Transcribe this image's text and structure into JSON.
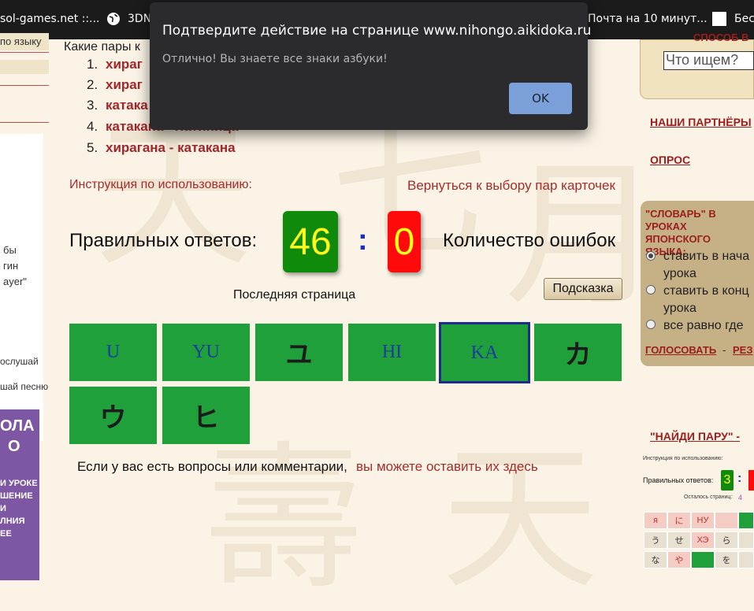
{
  "bookmarks": [
    {
      "label": "sol-games.net ::..."
    },
    {
      "label": "3DN"
    },
    {
      "label": "Почта на 10 минут..."
    },
    {
      "label": "Бес"
    }
  ],
  "dialog": {
    "title": "Подтвердите действие на странице www.nihongo.aikidoka.ru",
    "message": "Отлично! Вы знаете все знаки азбуки!",
    "ok_label": "OK"
  },
  "left": {
    "top_link": "по языку",
    "fragments": [
      "бы",
      "гин",
      "ayer\"",
      "ослушай",
      "шай песню"
    ],
    "promo_lines": [
      "ОЛА",
      "О",
      "И УРОКЕ",
      "ШЕНИЕ",
      "И",
      "ЛНИЯ",
      "ЕЕ"
    ]
  },
  "main": {
    "question": "Какие пары к",
    "pairs": [
      {
        "num": "1.",
        "label": "хираг"
      },
      {
        "num": "2.",
        "label": "хираг"
      },
      {
        "num": "3.",
        "label": "катака"
      },
      {
        "num": "4.",
        "label": "катакана - латиница"
      },
      {
        "num": "5.",
        "label": "хирагана - катакана"
      }
    ],
    "instructions_link": "Инструкция по использованию:",
    "back_link": "Вернуться к выбору пар карточек",
    "correct_label": "Правильных ответов:",
    "correct_count": "46",
    "separator": ":",
    "errors_count": "0",
    "errors_label": "Количество ошибок",
    "hint_label": "Подсказка",
    "last_page": "Последняя страница",
    "cards_row1": [
      {
        "text": "U",
        "type": "romaji"
      },
      {
        "text": "YU",
        "type": "romaji"
      },
      {
        "text": "ユ",
        "type": "kana"
      },
      {
        "text": "HI",
        "type": "romaji"
      },
      {
        "text": "KA",
        "type": "romaji",
        "selected": true
      },
      {
        "text": "カ",
        "type": "kana"
      }
    ],
    "cards_row2": [
      {
        "text": "ウ",
        "type": "kana"
      },
      {
        "text": "ヒ",
        "type": "kana"
      }
    ],
    "comments_text": "Если у вас есть вопросы или комментарии,",
    "comments_link": "вы можете оставить их здесь"
  },
  "right": {
    "search_heading": "СПОСОБ В",
    "search_placeholder": "Что ищем?",
    "partners": "НАШИ ПАРТНЁРЫ",
    "poll_heading": "ОПРОС",
    "poll_title": "\"СЛОВАРЬ\" В УРОКАХ ЯПОНСКОГО ЯЗЫКА:",
    "poll_options": [
      "ставить в нача",
      "урока",
      "ставить в конц",
      "урока",
      "все равно где"
    ],
    "vote_label": "ГОЛОСОВАТЬ",
    "results_label": "РЕЗ",
    "find_pair": "\"НАЙДИ ПАРУ\" -",
    "mini_instructions": "Инструкция по использованию:",
    "mini_correct": "Правильных ответов:",
    "mini_count": "3",
    "mini_pages": "Осталось страниц:",
    "mini_pages_num": "4",
    "mini_cells": [
      "я",
      "に",
      "НУ",
      "",
      "う",
      "せ",
      "ХЭ",
      "ら",
      "な",
      "や",
      "",
      "を"
    ]
  },
  "colors": {
    "card_green": "#1fa03a",
    "score_green": "#0f8a0a",
    "score_red": "#ff0a0a",
    "score_digit": "#ffff1a",
    "link_red": "#a52d2d"
  }
}
